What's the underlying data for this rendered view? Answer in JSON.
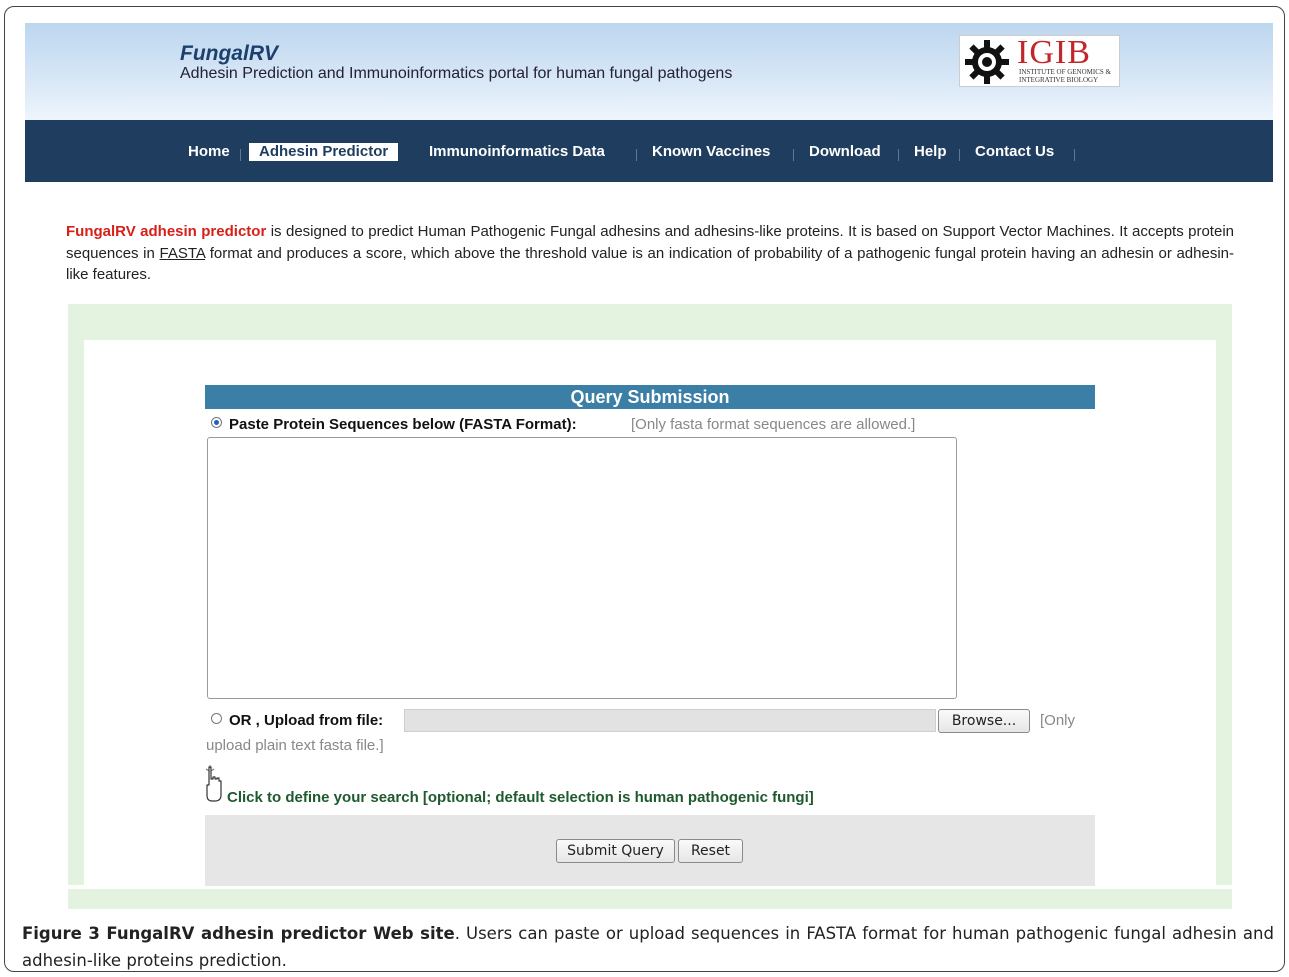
{
  "header": {
    "title": "FungalRV",
    "subtitle": "Adhesin Prediction and Immunoinformatics portal for human fungal pathogens",
    "logo": {
      "text": "IGIB",
      "subtext": "INSTITUTE OF GENOMICS & INTEGRATIVE BIOLOGY",
      "icon": "gear-icon"
    }
  },
  "nav": {
    "items": [
      {
        "label": "Home"
      },
      {
        "label": "Adhesin Predictor",
        "active": true
      },
      {
        "label": "Immunoinformatics Data"
      },
      {
        "label": "Known Vaccines"
      },
      {
        "label": "Download"
      },
      {
        "label": "Help"
      },
      {
        "label": "Contact Us"
      }
    ]
  },
  "intro": {
    "highlight": "FungalRV adhesin predictor",
    "text1": " is designed to predict Human Pathogenic Fungal adhesins and adhesins-like proteins. It is based on Support Vector Machines. It accepts protein sequences in ",
    "link": "FASTA",
    "text2": " format and produces a score, which above the threshold value is an indication of probability of a pathogenic fungal protein having an adhesin or adhesin-like features."
  },
  "form": {
    "header": "Query Submission",
    "paste_label": "Paste Protein Sequences below (FASTA Format):",
    "paste_note": "[Only fasta format sequences are allowed.]",
    "sequence_value": "",
    "upload_label": "OR , Upload from file:",
    "browse_label": "Browse...",
    "upload_note_1": "[Only",
    "upload_note_2": "upload plain text fasta file.]",
    "define_search": "Click to define your search [optional; default selection is human pathogenic fungi]",
    "submit_label": "Submit Query",
    "reset_label": "Reset"
  },
  "caption": {
    "figure_label": "Figure 3 FungalRV adhesin predictor Web site",
    "text": ". Users can paste or upload sequences in FASTA format for human pathogenic fungal adhesin and adhesin-like proteins prediction."
  },
  "colors": {
    "navbar": "#1f3d5e",
    "accent": "#3b7ea6",
    "highlight": "#d6201a",
    "panel": "#e4f3e0",
    "link_green": "#1f5a2e"
  }
}
